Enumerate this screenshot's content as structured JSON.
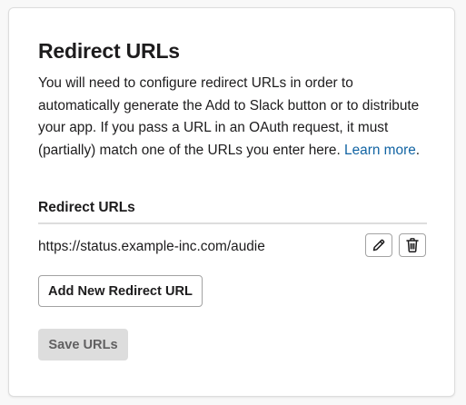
{
  "card": {
    "title": "Redirect URLs",
    "description_text": "You will need to configure redirect URLs in order to automatically generate the Add to Slack button or to distribute your app. If you pass a URL in an OAuth request, it must (partially) match one of the URLs you enter here. ",
    "learn_more_label": "Learn more",
    "description_end": "."
  },
  "redirect_urls": {
    "section_label": "Redirect URLs",
    "items": [
      {
        "url": "https://status.example-inc.com/audie"
      }
    ],
    "edit_icon": "pencil-icon",
    "delete_icon": "trash-icon"
  },
  "buttons": {
    "add_label": "Add New Redirect URL",
    "save_label": "Save URLs"
  },
  "colors": {
    "link": "#1264a3",
    "text": "#1d1c1d",
    "save_button_bg": "#dddddd",
    "save_button_text": "#616061",
    "border": "#a3a3a3"
  }
}
